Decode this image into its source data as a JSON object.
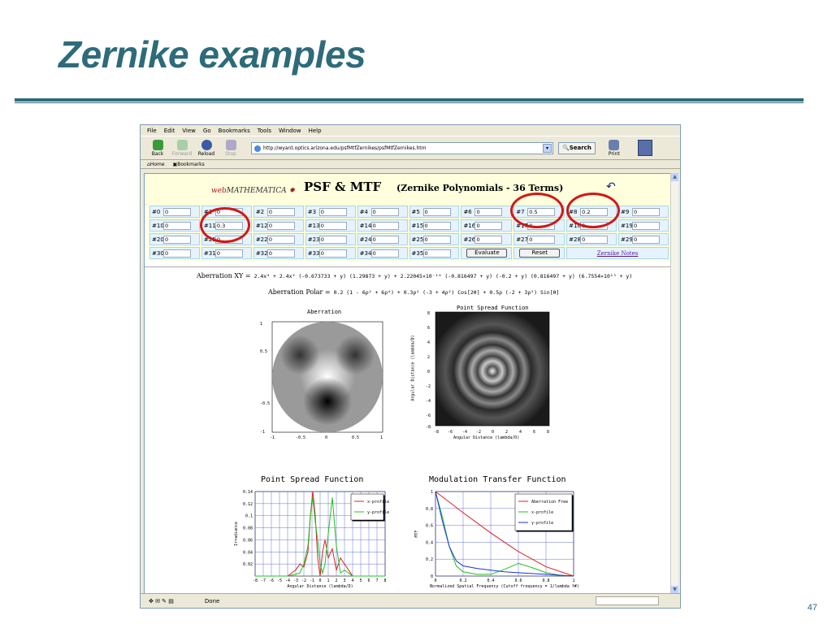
{
  "slide": {
    "title": "Zernike examples",
    "page_number": "47"
  },
  "browser": {
    "menu": [
      "File",
      "Edit",
      "View",
      "Go",
      "Bookmarks",
      "Tools",
      "Window",
      "Help"
    ],
    "nav": {
      "back": "Back",
      "forward": "Forward",
      "reload": "Reload",
      "stop": "Stop",
      "search": "Search",
      "print": "Print"
    },
    "address": "http://wyant.optics.arizona.edu/psfMtfZernikes/psfMtfZernikes.htm",
    "bookmarks": [
      "Home",
      "Bookmarks"
    ],
    "status": "Done"
  },
  "page": {
    "logo_web": "web",
    "logo_mathematica": "MATHEMATICA",
    "title": "PSF & MTF",
    "subtitle": "(Zernike Polynomials - 36 Terms)",
    "rows": [
      [
        [
          "#0",
          "0"
        ],
        [
          "#1",
          "0"
        ],
        [
          "#2",
          "0"
        ],
        [
          "#3",
          "0"
        ],
        [
          "#4",
          "0"
        ],
        [
          "#5",
          "0"
        ],
        [
          "#6",
          "0"
        ],
        [
          "#7",
          "0.5"
        ],
        [
          "#8",
          "0.2"
        ],
        [
          "#9",
          "0"
        ]
      ],
      [
        [
          "#10",
          "0"
        ],
        [
          "#11",
          "0.3"
        ],
        [
          "#12",
          "0"
        ],
        [
          "#13",
          "0"
        ],
        [
          "#14",
          "0"
        ],
        [
          "#15",
          "0"
        ],
        [
          "#16",
          "0"
        ],
        [
          "#17",
          "0"
        ],
        [
          "#18",
          "0"
        ],
        [
          "#19",
          "0"
        ]
      ],
      [
        [
          "#20",
          "0"
        ],
        [
          "#21",
          "0"
        ],
        [
          "#22",
          "0"
        ],
        [
          "#23",
          "0"
        ],
        [
          "#24",
          "0"
        ],
        [
          "#25",
          "0"
        ],
        [
          "#26",
          "0"
        ],
        [
          "#27",
          "0"
        ],
        [
          "#28",
          "0"
        ],
        [
          "#29",
          "0"
        ]
      ]
    ],
    "row4": [
      [
        "#30",
        "0"
      ],
      [
        "#31",
        "0"
      ],
      [
        "#32",
        "0"
      ],
      [
        "#33",
        "0"
      ],
      [
        "#34",
        "0"
      ],
      [
        "#35",
        "0"
      ]
    ],
    "evaluate": "Evaluate",
    "reset": "Reset",
    "zernike_notes": "Zernike Notes",
    "aberration_xy_label": "Aberration XY =",
    "aberration_xy": "2.4x⁴ + 2.4x² (-0.673733 + y) (1.29873 + y) + 2.22045×10⁻¹⁶ (-0.816497 + y) (-0.2 + y) (0.816497 + y) (6.7554×10¹⁵ + y)",
    "aberration_polar_label": "Aberration Polar =",
    "aberration_polar": "0.2 (1 - 6ρ² + 6ρ⁴) + 0.3ρ² (-3 + 4ρ²) Cos[2θ] + 0.5ρ (-2 + 3ρ²) Sin[θ]",
    "aberration_plot_title": "Aberration",
    "psf_image_title": "Point Spread Function",
    "psf_image_ylabel": "Angular Distance (lambda/D)",
    "psf_image_xlabel": "Angular Distance (lambda/D)",
    "psf_plot_title": "Point Spread Function",
    "mtf_plot_title": "Modulation Transfer Function"
  },
  "chart_data": [
    {
      "type": "line",
      "title": "Point Spread Function",
      "xlabel": "Angular Distance (lambda/D)",
      "ylabel": "Irradiance",
      "xlim": [
        -8,
        8
      ],
      "ylim": [
        0,
        0.14
      ],
      "xticks": [
        "-8",
        "-7",
        "-6",
        "-5",
        "-4",
        "-3",
        "-2",
        "-1",
        "0",
        "1",
        "2",
        "3",
        "4",
        "5",
        "6",
        "7",
        "8"
      ],
      "yticks": [
        "0.02",
        "0.04",
        "0.06",
        "0.08",
        "0.1",
        "0.12",
        "0.14"
      ],
      "series": [
        {
          "name": "x-profile",
          "color": "#e02020",
          "x": [
            -8,
            -4,
            -3.5,
            -3,
            -2.5,
            -2,
            -1.5,
            -1.2,
            -0.9,
            -0.6,
            -0.3,
            0,
            0.3,
            0.6,
            1,
            1.5,
            2,
            2.5,
            3,
            3.5,
            4,
            8
          ],
          "y": [
            0,
            0,
            0.005,
            0.01,
            0.02,
            0.015,
            0.04,
            0.1,
            0.14,
            0.1,
            0.03,
            0,
            0.04,
            0.06,
            0.03,
            0.045,
            0.01,
            0.03,
            0.02,
            0.01,
            0,
            0
          ]
        },
        {
          "name": "y-profile",
          "color": "#20c020",
          "x": [
            -8,
            -4,
            -3,
            -2.5,
            -2,
            -1.5,
            -1.2,
            -0.9,
            -0.6,
            -0.3,
            0,
            0.3,
            0.6,
            1,
            1.5,
            2,
            2.5,
            3,
            4,
            8
          ],
          "y": [
            0,
            0,
            0.003,
            0.005,
            0.02,
            0.05,
            0.1,
            0.13,
            0.09,
            0.06,
            0.02,
            0.005,
            0.02,
            0.07,
            0.13,
            0.05,
            0.005,
            0.01,
            0,
            0
          ]
        }
      ],
      "legend": "top-right",
      "grid": true
    },
    {
      "type": "line",
      "title": "Modulation Transfer Function",
      "xlabel": "Normalized Spatial Frequency (Cutoff frequency = 1/lambda f#)",
      "ylabel": "MTF",
      "xlim": [
        0,
        1
      ],
      "ylim": [
        0,
        1
      ],
      "xticks": [
        "0",
        "0.2",
        "0.4",
        "0.6",
        "0.8",
        "1"
      ],
      "yticks": [
        "0",
        "0.2",
        "0.4",
        "0.6",
        "0.8",
        "1"
      ],
      "series": [
        {
          "name": "Aberration Free",
          "color": "#e02020",
          "x": [
            0,
            0.2,
            0.4,
            0.6,
            0.8,
            1
          ],
          "y": [
            1,
            0.75,
            0.51,
            0.29,
            0.11,
            0
          ]
        },
        {
          "name": "x-profile",
          "color": "#20c020",
          "x": [
            0,
            0.05,
            0.1,
            0.15,
            0.2,
            0.3,
            0.4,
            0.5,
            0.6,
            0.7,
            0.8,
            0.9,
            1
          ],
          "y": [
            1,
            0.7,
            0.35,
            0.12,
            0.05,
            0.02,
            0.02,
            0.08,
            0.15,
            0.1,
            0.04,
            0.01,
            0
          ]
        },
        {
          "name": "y-profile",
          "color": "#2030e0",
          "x": [
            0,
            0.05,
            0.1,
            0.15,
            0.2,
            0.3,
            0.4,
            0.5,
            0.6,
            0.7,
            0.8,
            0.9,
            1
          ],
          "y": [
            1,
            0.65,
            0.35,
            0.18,
            0.12,
            0.09,
            0.07,
            0.05,
            0.04,
            0.03,
            0.02,
            0.01,
            0
          ]
        }
      ],
      "legend": "top-right",
      "grid": true
    }
  ]
}
